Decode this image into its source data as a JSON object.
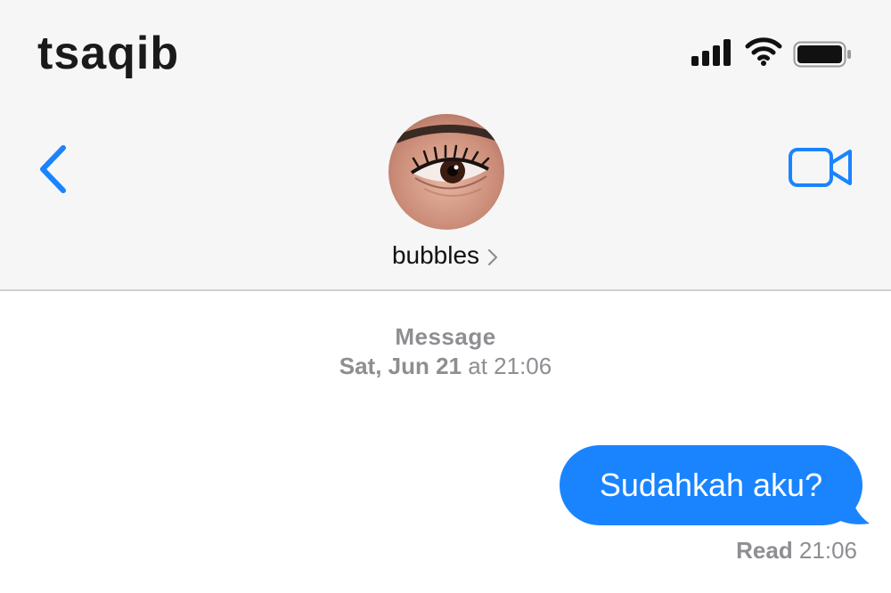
{
  "status_bar": {
    "title": "tsaqib",
    "icons": [
      "cellular-signal-icon",
      "wifi-icon",
      "battery-icon"
    ]
  },
  "nav": {
    "back_icon": "chevron-left-icon",
    "video_icon": "video-camera-icon",
    "contact_name": "bubbles",
    "contact_chevron_icon": "chevron-right-icon"
  },
  "conversation": {
    "service_label": "Message",
    "date_bold": "Sat, Jun 21",
    "date_rest": " at 21:06",
    "messages": [
      {
        "text": "Sudahkah aku?",
        "direction": "outgoing"
      }
    ],
    "read_label": "Read",
    "read_time": " 21:06"
  },
  "colors": {
    "accent": "#1a84ff",
    "bubble_text": "#ffffff",
    "meta_text": "#8e8e93",
    "header_bg": "#f6f6f6"
  }
}
